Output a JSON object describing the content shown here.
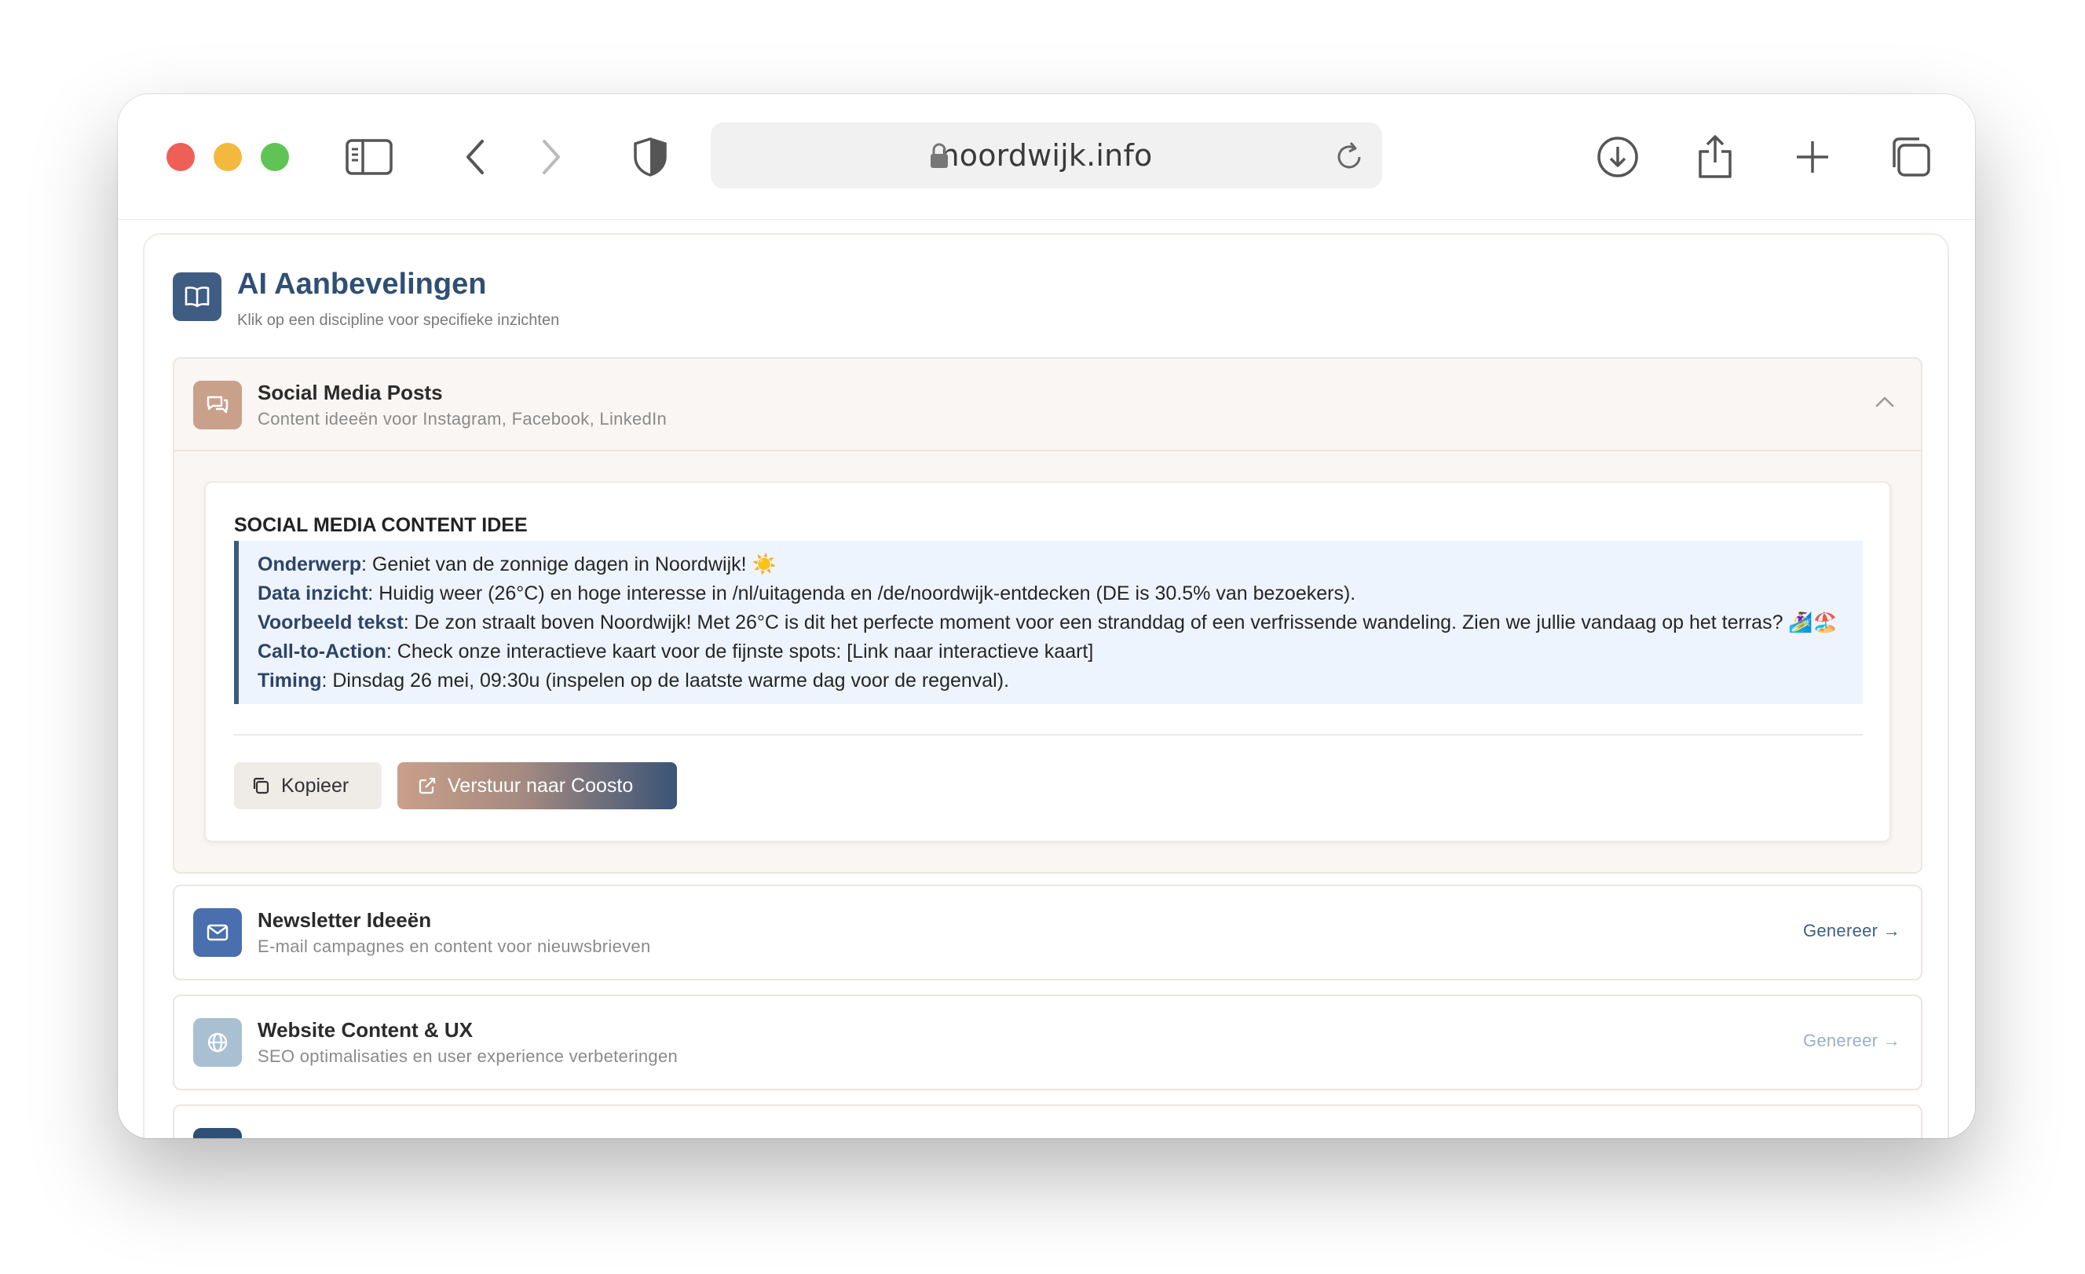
{
  "browser": {
    "url": "noordwijk.info",
    "icons": [
      "sidebar-icon",
      "back-icon",
      "forward-icon",
      "shield-icon",
      "lock-icon",
      "reload-icon",
      "download-icon",
      "share-icon",
      "new-tab-icon",
      "tabs-icon"
    ]
  },
  "header": {
    "title": "AI Aanbevelingen",
    "subtitle": "Klik op een discipline voor specifieke inzichten"
  },
  "sections": {
    "social": {
      "title": "Social Media Posts",
      "description": "Content ideeën voor Instagram, Facebook, LinkedIn",
      "card_heading": "SOCIAL MEDIA CONTENT IDEE",
      "lines": [
        {
          "label": "Onderwerp",
          "text": ": Geniet van de zonnige dagen in Noordwijk! ☀️"
        },
        {
          "label": "Data inzicht",
          "text": ": Huidig weer (26°C) en hoge interesse in /nl/uitagenda en /de/noordwijk-entdecken (DE is 30.5% van bezoekers)."
        },
        {
          "label": "Voorbeeld tekst",
          "text": ": De zon straalt boven Noordwijk! Met 26°C is dit het perfecte moment voor een stranddag of een verfrissende wandeling. Zien we jullie vandaag op het terras? 🏄‍♀️🏖️"
        },
        {
          "label": "Call-to-Action",
          "text": ": Check onze interactieve kaart voor de fijnste spots: [Link naar interactieve kaart]"
        },
        {
          "label": "Timing",
          "text": ": Dinsdag 26 mei, 09:30u (inspelen op de laatste warme dag voor de regenval)."
        }
      ],
      "copy_label": "Kopieer",
      "send_label": "Verstuur naar Coosto"
    },
    "newsletter": {
      "title": "Newsletter Ideeën",
      "description": "E-mail campagnes en content voor nieuwsbrieven",
      "action": "Genereer →"
    },
    "website": {
      "title": "Website Content & UX",
      "description": "SEO optimalisaties en user experience verbeteringen",
      "action": "Genereer →"
    }
  },
  "colors": {
    "brand_dark": "#3f5d82",
    "social_icon": "#c9a08a",
    "newsletter_icon": "#4a6fae",
    "website_icon": "#a9c0d2",
    "note_bg": "#eef4fd"
  }
}
